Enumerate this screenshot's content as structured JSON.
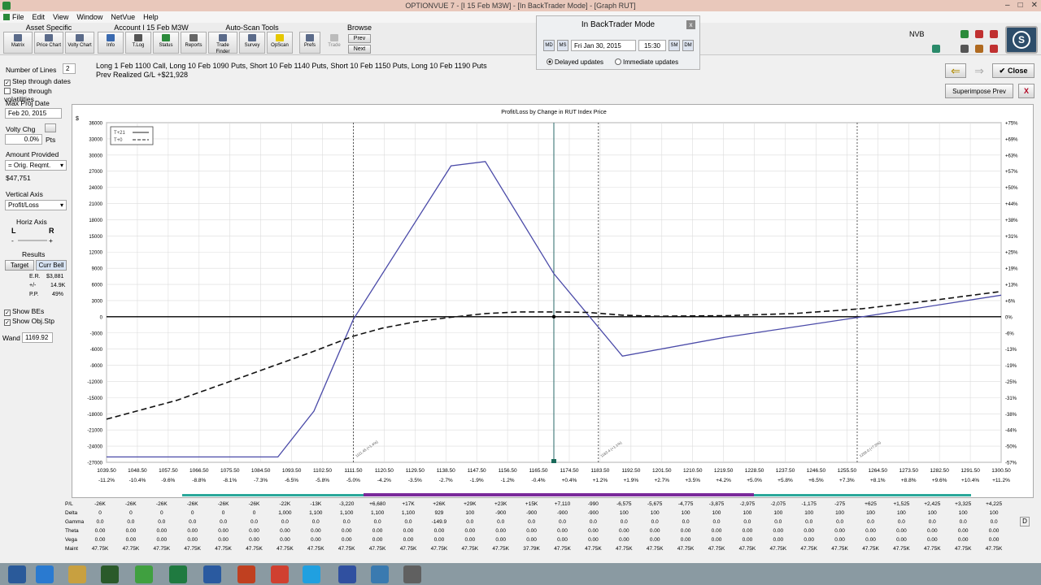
{
  "window": {
    "title": "OPTIONVUE 7 - [I 15 Feb M3W] - [In BackTrader Mode] - [Graph RUT]"
  },
  "menu": [
    "File",
    "Edit",
    "View",
    "Window",
    "NetVue",
    "Help"
  ],
  "toolbar": {
    "asset_specific": {
      "title": "Asset Specific",
      "buttons": [
        "Matrix",
        "Price Chart",
        "Volty Chart"
      ]
    },
    "account": {
      "title": "Account I 15 Feb M3W",
      "buttons": [
        "Info",
        "T.Log",
        "Status",
        "Reports"
      ]
    },
    "autoscan": {
      "title": "Auto-Scan Tools",
      "buttons": [
        "Trade Finder",
        "Survey",
        "OpScan"
      ]
    },
    "extra_buttons": [
      "Prefs",
      "Trade"
    ],
    "browse": {
      "title": "Browse",
      "prev": "Prev",
      "next": "Next"
    }
  },
  "backtrader": {
    "title": "In BackTrader Mode",
    "close": "x",
    "btn_md": "MD",
    "btn_ms": "MS",
    "date": "Fri Jan 30, 2015",
    "time": "15:30",
    "btn_sm": "SM",
    "btn_dm": "DM",
    "radio_delayed": "Delayed updates",
    "radio_immediate": "Immediate updates"
  },
  "nvb_label": "NVB",
  "position": {
    "description": "Long 1 Feb 1100 Call, Long 10 Feb 1090 Puts, Short 10 Feb 1140 Puts, Short 10 Feb 1150 Puts, Long 10 Feb 1190 Puts",
    "prev_realized": "Prev Realized G/L +$21,928"
  },
  "nav": {
    "close": "Close",
    "superimpose": "Superimpose Prev",
    "close_x": "X"
  },
  "left": {
    "number_of_lines_label": "Number of Lines",
    "number_of_lines": "2",
    "step_dates": "Step through dates",
    "step_vols": "Step through volatilities",
    "max_proj_date_label": "Max Proj Date",
    "max_proj_date": "Feb 20, 2015",
    "volty_chg_label": "Volty Chg",
    "volty_chg": "0.0%",
    "volty_unit": "Pts",
    "amount_provided_label": "Amount Provided",
    "amount_provided": "= Orig. Reqmt.",
    "amount_value": "$47,751",
    "vertical_axis_label": "Vertical Axis",
    "vertical_axis": "Profit/Loss",
    "horiz_axis_label": "Horiz Axis",
    "horiz_l": "L",
    "horiz_r": "R",
    "horiz_minus": "-",
    "horiz_plus": "+",
    "results_label": "Results",
    "target": "Target",
    "curr_bell": "Curr Bell",
    "er_label": "E.R.",
    "er_value": "$3,881",
    "pm_label": "+/-",
    "pm_value": "14.9K",
    "pp_label": "P.P.",
    "pp_value": "49%",
    "show_bes": "Show BEs",
    "show_objstp": "Show Obj.Stp",
    "wand_label": "Wand",
    "wand_value": "1169.92"
  },
  "chart_data": {
    "type": "line",
    "title": "Profit/Loss by Change in RUT Index Price",
    "ylabel": "$",
    "ylim": [
      -27000,
      36000
    ],
    "xlim": [
      1039.5,
      1300.5
    ],
    "y_ticks": [
      36000,
      33000,
      30000,
      27000,
      24000,
      21000,
      18000,
      15000,
      12000,
      9000,
      6000,
      3000,
      0,
      -3000,
      -6000,
      -9000,
      -12000,
      -15000,
      -18000,
      -21000,
      -24000,
      -27000
    ],
    "y_tick_labels": [
      "36000",
      "33000",
      "30000",
      "27000",
      "24000",
      "21000",
      "18000",
      "15000",
      "12000",
      "9000",
      "6000",
      "3000",
      "0",
      "-3000",
      "-6000",
      "-9000",
      "-12000",
      "-15000",
      "-18000",
      "-21000",
      "-24000",
      "-27000"
    ],
    "right_tick_labels": [
      "+75%",
      "+69%",
      "+63%",
      "+57%",
      "+50%",
      "+44%",
      "+38%",
      "+31%",
      "+25%",
      "+19%",
      "+13%",
      "+6%",
      "0%",
      "-6%",
      "-13%",
      "-19%",
      "-25%",
      "-31%",
      "-38%",
      "-44%",
      "-50%",
      "-57%"
    ],
    "x_ticks": [
      1039.5,
      1048.5,
      1057.5,
      1066.5,
      1075.5,
      1084.5,
      1093.5,
      1102.5,
      1111.5,
      1120.5,
      1129.5,
      1138.5,
      1147.5,
      1156.5,
      1165.5,
      1174.5,
      1183.5,
      1192.5,
      1201.5,
      1210.5,
      1219.5,
      1228.5,
      1237.5,
      1246.5,
      1255.5,
      1264.5,
      1273.5,
      1282.5,
      1291.5,
      1300.5
    ],
    "x_tick_labels": [
      "1039.50",
      "1048.50",
      "1057.50",
      "1066.50",
      "1075.50",
      "1084.50",
      "1093.50",
      "1102.50",
      "1111.50",
      "1120.50",
      "1129.50",
      "1138.50",
      "1147.50",
      "1156.50",
      "1165.50",
      "1174.50",
      "1183.50",
      "1192.50",
      "1201.50",
      "1210.50",
      "1219.50",
      "1228.50",
      "1237.50",
      "1246.50",
      "1255.50",
      "1264.50",
      "1273.50",
      "1282.50",
      "1291.50",
      "1300.50"
    ],
    "x_pct_labels": [
      "-11.2%",
      "-10.4%",
      "-9.6%",
      "-8.8%",
      "-8.1%",
      "-7.3%",
      "-6.5%",
      "-5.8%",
      "-5.0%",
      "-4.2%",
      "-3.5%",
      "-2.7%",
      "-1.9%",
      "-1.2%",
      "-0.4%",
      "+0.4%",
      "+1.2%",
      "+1.9%",
      "+2.7%",
      "+3.5%",
      "+4.2%",
      "+5.0%",
      "+5.8%",
      "+6.5%",
      "+7.3%",
      "+8.1%",
      "+8.8%",
      "+9.6%",
      "+10.4%",
      "+11.2%"
    ],
    "legend": [
      {
        "label": "T+21"
      },
      {
        "label": "T+0"
      }
    ],
    "series": [
      {
        "name": "T+21",
        "color": "#4a4aa8",
        "dash": false,
        "x": [
          1039.5,
          1089.5,
          1100,
          1111.5,
          1140,
          1150,
          1170,
          1190,
          1220,
          1260,
          1300.5
        ],
        "y": [
          -26000,
          -26000,
          -17500,
          -500,
          28000,
          28800,
          8000,
          -7300,
          -3800,
          0,
          4000
        ]
      },
      {
        "name": "T+0",
        "color": "#111111",
        "dash": true,
        "x": [
          1039.5,
          1060,
          1080,
          1100,
          1111.5,
          1120,
          1130,
          1140,
          1150,
          1160,
          1170,
          1180,
          1190,
          1200,
          1220,
          1240,
          1260,
          1280,
          1300.5
        ],
        "y": [
          -19000,
          -15500,
          -11000,
          -6400,
          -3600,
          -2100,
          -900,
          -100,
          600,
          900,
          900,
          800,
          300,
          100,
          200,
          600,
          1500,
          3000,
          4700
        ]
      }
    ],
    "vlines": [
      {
        "x": 1111.5,
        "label": "1111.45 (+1.4%)",
        "style": "dashed"
      },
      {
        "x": 1170,
        "label": "",
        "style": "solid"
      },
      {
        "x": 1183,
        "label": "1183.4 (+1.1%)",
        "style": "dashed"
      },
      {
        "x": 1258.5,
        "label": "1258.0 (+7.5%)",
        "style": "dashed"
      }
    ],
    "marker": {
      "x": 1170,
      "y": 0
    }
  },
  "greeks_table": {
    "row_labels": [
      "P/L",
      "Delta",
      "Gamma",
      "Theta",
      "Vega",
      "Maint"
    ],
    "columns": [
      [
        "-26K",
        "0",
        "0.0",
        "0.00",
        "0.00",
        "47.75K"
      ],
      [
        "-26K",
        "0",
        "0.0",
        "0.00",
        "0.00",
        "47.75K"
      ],
      [
        "-26K",
        "0",
        "0.0",
        "0.00",
        "0.00",
        "47.75K"
      ],
      [
        "-26K",
        "0",
        "0.0",
        "0.00",
        "0.00",
        "47.75K"
      ],
      [
        "-26K",
        "0",
        "0.0",
        "0.00",
        "0.00",
        "47.75K"
      ],
      [
        "-26K",
        "0",
        "0.0",
        "0.00",
        "0.00",
        "47.75K"
      ],
      [
        "-22K",
        "1,000",
        "0.0",
        "0.00",
        "0.00",
        "47.75K"
      ],
      [
        "-13K",
        "1,100",
        "0.0",
        "0.00",
        "0.00",
        "47.75K"
      ],
      [
        "-3,220",
        "1,100",
        "0.0",
        "0.00",
        "0.00",
        "47.75K"
      ],
      [
        "+6,680",
        "1,100",
        "0.0",
        "0.00",
        "0.00",
        "47.75K"
      ],
      [
        "+17K",
        "1,100",
        "0.0",
        "0.00",
        "0.00",
        "47.75K"
      ],
      [
        "+26K",
        "929",
        "-149.9",
        "0.00",
        "0.00",
        "47.75K"
      ],
      [
        "+29K",
        "100",
        "0.0",
        "0.00",
        "0.00",
        "47.75K"
      ],
      [
        "+23K",
        "-900",
        "0.0",
        "0.00",
        "0.00",
        "47.75K"
      ],
      [
        "+15K",
        "-900",
        "0.0",
        "0.00",
        "0.00",
        "37.79K"
      ],
      [
        "+7,110",
        "-900",
        "0.0",
        "0.00",
        "0.00",
        "47.75K"
      ],
      [
        "-990",
        "-900",
        "0.0",
        "0.00",
        "0.00",
        "47.75K"
      ],
      [
        "-6,575",
        "100",
        "0.0",
        "0.00",
        "0.00",
        "47.75K"
      ],
      [
        "-5,675",
        "100",
        "0.0",
        "0.00",
        "0.00",
        "47.75K"
      ],
      [
        "-4,775",
        "100",
        "0.0",
        "0.00",
        "0.00",
        "47.75K"
      ],
      [
        "-3,875",
        "100",
        "0.0",
        "0.00",
        "0.00",
        "47.75K"
      ],
      [
        "-2,975",
        "100",
        "0.0",
        "0.00",
        "0.00",
        "47.75K"
      ],
      [
        "-2,075",
        "100",
        "0.0",
        "0.00",
        "0.00",
        "47.75K"
      ],
      [
        "-1,175",
        "100",
        "0.0",
        "0.00",
        "0.00",
        "47.75K"
      ],
      [
        "-275",
        "100",
        "0.0",
        "0.00",
        "0.00",
        "47.75K"
      ],
      [
        "+625",
        "100",
        "0.0",
        "0.00",
        "0.00",
        "47.75K"
      ],
      [
        "+1,525",
        "100",
        "0.0",
        "0.00",
        "0.00",
        "47.75K"
      ],
      [
        "+2,425",
        "100",
        "0.0",
        "0.00",
        "0.00",
        "47.75K"
      ],
      [
        "+3,325",
        "100",
        "0.0",
        "0.00",
        "0.00",
        "47.75K"
      ],
      [
        "+4,225",
        "100",
        "0.0",
        "0.00",
        "0.00",
        "47.75K"
      ]
    ]
  },
  "taskbar": {
    "icons": [
      "windows-start-icon",
      "ie-icon",
      "explorer-icon",
      "app-icon",
      "chrome-alt-icon",
      "excel-icon",
      "word-icon",
      "powerpoint-icon",
      "chrome-icon",
      "skype-icon",
      "flower-icon",
      "photos-icon",
      "optionvue-icon"
    ]
  },
  "colors": {
    "series1": "#4a4aa8",
    "series2": "#111111",
    "accent_purple": "#7a2a9a",
    "accent_teal": "#2aa89a"
  }
}
